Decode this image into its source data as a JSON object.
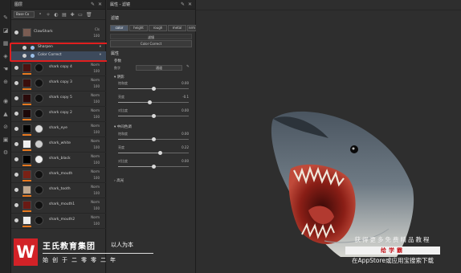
{
  "layers_panel": {
    "title": "图层",
    "blend_mode": "Base Co",
    "layers": [
      {
        "name": "ClawShark",
        "blend": "Cls",
        "opacity": "100"
      },
      {
        "name": "shark copy 4",
        "blend": "Norm",
        "opacity": "100"
      },
      {
        "name": "shark copy 3",
        "blend": "Norm",
        "opacity": "100"
      },
      {
        "name": "shark copy 5",
        "blend": "Norm",
        "opacity": "100"
      },
      {
        "name": "shark copy 2",
        "blend": "Norm",
        "opacity": "100"
      },
      {
        "name": "shark_eye",
        "blend": "Norm",
        "opacity": "100"
      },
      {
        "name": "shark_white",
        "blend": "Norm",
        "opacity": "100"
      },
      {
        "name": "shark_black",
        "blend": "Norm",
        "opacity": "100"
      },
      {
        "name": "shark_mouth",
        "blend": "Norm",
        "opacity": "100"
      },
      {
        "name": "shark_tooth",
        "blend": "Norm",
        "opacity": "100"
      },
      {
        "name": "shark_mouth1",
        "blend": "Norm",
        "opacity": "100"
      },
      {
        "name": "shark_mouth2",
        "blend": "Norm",
        "opacity": "100"
      }
    ],
    "filters": [
      {
        "name": "Sharpen"
      },
      {
        "name": "Color Correct"
      }
    ]
  },
  "properties_panel": {
    "title": "属性 - 滤镜",
    "section_filter": "滤镜",
    "channels": [
      "color",
      "height",
      "rough",
      "metal",
      "nrm"
    ],
    "filter_label": "滤镜",
    "filter_name": "Color Correct",
    "section_params": "属性",
    "group_general": "参数",
    "gain_label": "数字",
    "gain_value": "通道",
    "group_shadow": "阴影",
    "group_midtone": "中间色调",
    "group_highlight": "高光",
    "params_shadow": [
      {
        "label": "饱和度",
        "value": "0.00",
        "pos": 0.5
      },
      {
        "label": "亮度",
        "value": "-0.1",
        "pos": 0.45
      },
      {
        "label": "对比度",
        "value": "0.00",
        "pos": 0.5
      }
    ],
    "params_midtone": [
      {
        "label": "饱和度",
        "value": "0.00",
        "pos": 0.5
      },
      {
        "label": "亮度",
        "value": "0.22",
        "pos": 0.6
      },
      {
        "label": "对比度",
        "value": "0.00",
        "pos": 0.5
      }
    ]
  },
  "colors": {
    "accent_orange": "#e8791f",
    "highlight_red": "#e01e1e",
    "brand_red": "#d22227"
  },
  "watermark": {
    "line1": "获得更多免费精品教程",
    "line2": "给学霸",
    "line3": "在AppStore或应用宝搜索下载"
  },
  "brand": {
    "logo_letter": "W",
    "name": "王氏教育集团",
    "slogan": "以人为本",
    "subline": "始创于二零零二年"
  }
}
